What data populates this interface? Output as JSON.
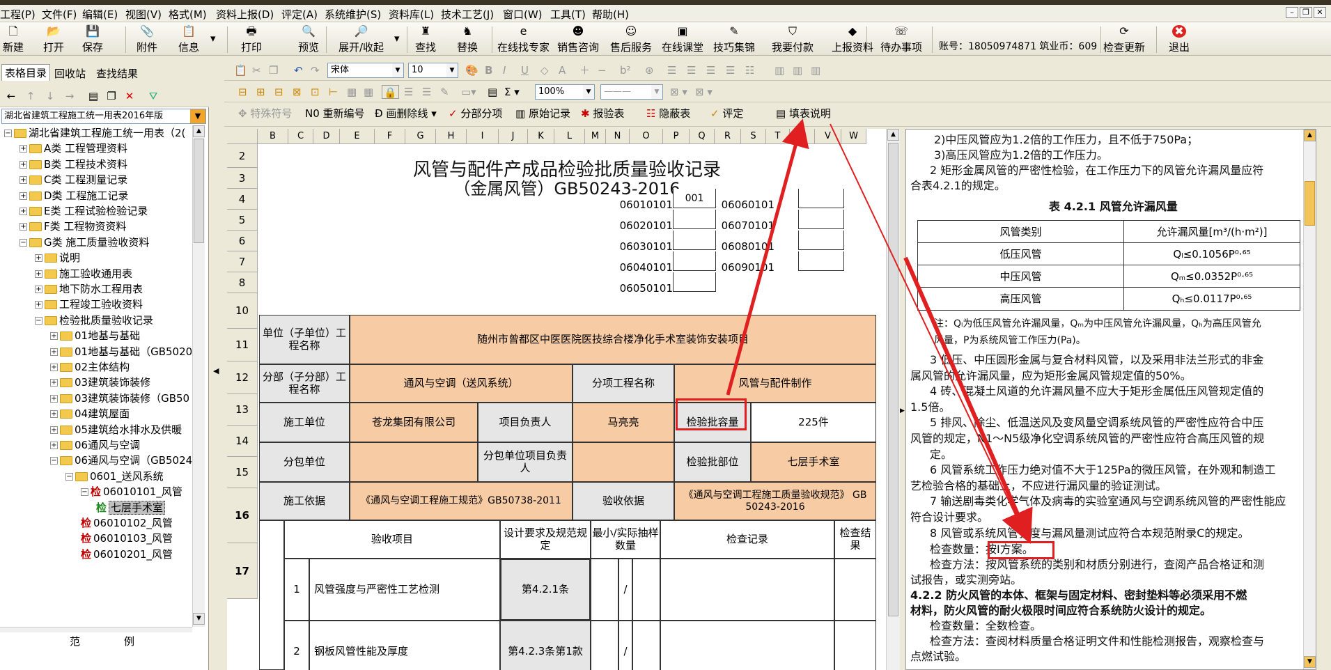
{
  "menu": [
    "工程(P)",
    "文件(F)",
    "编辑(E)",
    "视图(V)",
    "格式(M)",
    "资料上报(D)",
    "评定(A)",
    "系统维护(S)",
    "资料库(L)",
    "技术工艺(J)",
    "窗口(W)",
    "工具(T)",
    "帮助(H)"
  ],
  "window_controls": [
    "–",
    "❐",
    "✕"
  ],
  "toolbar": {
    "items": [
      {
        "label": "新建",
        "icon": "new-icon",
        "glyph": "🗋"
      },
      {
        "label": "打开",
        "icon": "open-icon",
        "glyph": "📂"
      },
      {
        "label": "保存",
        "icon": "save-icon",
        "glyph": "💾"
      },
      {
        "label": "附件",
        "icon": "attachment-icon",
        "glyph": "📎"
      },
      {
        "label": "信息",
        "icon": "info-icon",
        "glyph": "📋"
      },
      {
        "label": "打印",
        "icon": "print-icon",
        "glyph": "🖶"
      },
      {
        "label": "预览",
        "icon": "preview-icon",
        "glyph": "🔍"
      },
      {
        "label": "展开/收起",
        "icon": "expand-icon",
        "glyph": "🔎"
      },
      {
        "label": "查找",
        "icon": "find-icon",
        "glyph": "♜"
      },
      {
        "label": "替换",
        "icon": "replace-icon",
        "glyph": "♞"
      },
      {
        "label": "在线找专家",
        "icon": "expert-icon",
        "glyph": "e"
      },
      {
        "label": "销售咨询",
        "icon": "sales-icon",
        "glyph": "☻"
      },
      {
        "label": "售后服务",
        "icon": "service-icon",
        "glyph": "☺"
      },
      {
        "label": "在线课堂",
        "icon": "classroom-icon",
        "glyph": "▣"
      },
      {
        "label": "技巧集锦",
        "icon": "tips-icon",
        "glyph": "✎"
      },
      {
        "label": "我要付款",
        "icon": "pay-icon",
        "glyph": "⛉"
      },
      {
        "label": "上报资料",
        "icon": "upload-icon",
        "glyph": "◆"
      },
      {
        "label": "待办事项",
        "icon": "todo-icon",
        "glyph": "☏"
      },
      {
        "label": "检查更新",
        "icon": "update-icon",
        "glyph": "⟳"
      },
      {
        "label": "退出",
        "icon": "exit-icon",
        "glyph": "✖"
      }
    ],
    "account": "账号：18050974871 筑业币：609"
  },
  "left": {
    "tabs": [
      "表格目录",
      "回收站",
      "查找结果"
    ],
    "selector": "湖北省建筑工程施工统一用表2016年版",
    "tree": [
      {
        "level": 0,
        "label": "湖北省建筑工程施工统一用表（2(",
        "exp": "−",
        "type": "folder"
      },
      {
        "level": 1,
        "label": "A类 工程管理资料",
        "exp": "+",
        "type": "folder"
      },
      {
        "level": 1,
        "label": "B类 工程技术资料",
        "exp": "+",
        "type": "folder"
      },
      {
        "level": 1,
        "label": "C类 工程测量记录",
        "exp": "+",
        "type": "folder"
      },
      {
        "level": 1,
        "label": "D类 工程施工记录",
        "exp": "+",
        "type": "folder"
      },
      {
        "level": 1,
        "label": "E类 工程试验检验记录",
        "exp": "+",
        "type": "folder"
      },
      {
        "level": 1,
        "label": "F类 工程物资资料",
        "exp": "+",
        "type": "folder"
      },
      {
        "level": 1,
        "label": "G类 施工质量验收资料",
        "exp": "−",
        "type": "folder"
      },
      {
        "level": 2,
        "label": "说明",
        "exp": "+",
        "type": "folder"
      },
      {
        "level": 2,
        "label": "施工验收通用表",
        "exp": "+",
        "type": "folder"
      },
      {
        "level": 2,
        "label": "地下防水工程用表",
        "exp": "+",
        "type": "folder"
      },
      {
        "level": 2,
        "label": "工程竣工验收资料",
        "exp": "+",
        "type": "folder"
      },
      {
        "level": 2,
        "label": "检验批质量验收记录",
        "exp": "−",
        "type": "folder"
      },
      {
        "level": 3,
        "label": "01地基与基础",
        "exp": "+",
        "type": "folder"
      },
      {
        "level": 3,
        "label": "01地基与基础（GB5020",
        "exp": "+",
        "type": "folder"
      },
      {
        "level": 3,
        "label": "02主体结构",
        "exp": "+",
        "type": "folder"
      },
      {
        "level": 3,
        "label": "03建筑装饰装修",
        "exp": "+",
        "type": "folder"
      },
      {
        "level": 3,
        "label": "03建筑装饰装修（GB50",
        "exp": "+",
        "type": "folder"
      },
      {
        "level": 3,
        "label": "04建筑屋面",
        "exp": "+",
        "type": "folder"
      },
      {
        "level": 3,
        "label": "05建筑给水排水及供暖",
        "exp": "+",
        "type": "folder"
      },
      {
        "level": 3,
        "label": "06通风与空调",
        "exp": "+",
        "type": "folder"
      },
      {
        "level": 3,
        "label": "06通风与空调（GB5024",
        "exp": "−",
        "type": "folder"
      },
      {
        "level": 4,
        "label": "0601_送风系统",
        "exp": "−",
        "type": "folder"
      },
      {
        "level": 5,
        "label": "06010101_风管",
        "exp": "−",
        "type": "doc",
        "mark": "检"
      },
      {
        "level": 6,
        "label": "七层手术室",
        "exp": "",
        "type": "docg",
        "mark": "检",
        "selected": true
      },
      {
        "level": 5,
        "label": "06010102_风管",
        "exp": "",
        "type": "doc",
        "mark": "检"
      },
      {
        "level": 5,
        "label": "06010103_风管",
        "exp": "",
        "type": "doc",
        "mark": "检"
      },
      {
        "level": 5,
        "label": "06010201_风管",
        "exp": "",
        "type": "doc",
        "mark": "检"
      }
    ],
    "footer": [
      "范",
      "例"
    ]
  },
  "edit": {
    "font": "宋体",
    "size": "10",
    "zoom": "100%",
    "row3": [
      "特殊符号",
      "重新编号",
      "画删除线",
      "分部分项",
      "原始记录",
      "报验表",
      "隐蔽表",
      "评定",
      "填表说明"
    ]
  },
  "sheet": {
    "cols": [
      "B",
      "C",
      "D",
      "E",
      "F",
      "G",
      "H",
      "I",
      "J",
      "K",
      "L",
      "M",
      "N",
      "O",
      "P",
      "Q",
      "R",
      "S",
      "T",
      "U",
      "V",
      "W"
    ],
    "rows": [
      "2",
      "3",
      "4",
      "5",
      "6",
      "7",
      "8",
      "10",
      "11",
      "12",
      "13",
      "14",
      "15",
      "16",
      "17"
    ],
    "title1": "风管与配件产成品检验批质量验收记录",
    "title2": "（金属风管）GB50243-2016",
    "codes_left": [
      "06010101",
      "06020101",
      "06030101",
      "06040101",
      "06050101"
    ],
    "codes_left_vals": [
      "001",
      "",
      "",
      "",
      ""
    ],
    "codes_right": [
      "06060101",
      "06070101",
      "06080101",
      "06090101"
    ],
    "unit_label": "单位（子单位）工程名称",
    "unit_value": "随州市曾都区中医医院医技综合楼净化手术室装饰安装项目",
    "sub_label": "分部（子分部）工程名称",
    "sub_value": "通风与空调（送风系统）",
    "item_label": "分项工程名称",
    "item_value": "风管与配件制作",
    "constr_label": "施工单位",
    "constr_value": "苍龙集团有限公司",
    "pm_label": "项目负责人",
    "pm_value": "马亮亮",
    "cap_label": "检验批容量",
    "cap_value": "225件",
    "subc_label": "分包单位",
    "subc_pm_label": "分包单位项目负责人",
    "part_label": "检验批部位",
    "part_value": "七层手术室",
    "basis_label": "施工依据",
    "basis_value": "《通风与空调工程施工规范》GB50738-2011",
    "accept_label": "验收依据",
    "accept_value": "《通风与空调工程施工质量验收规范》 GB 50243-2016",
    "hdr_item": "验收项目",
    "hdr_design": "设计要求及规范规定",
    "hdr_sample": "最小/实际抽样数量",
    "hdr_record": "检查记录",
    "hdr_result": "检查结果",
    "r1_no": "1",
    "r1_item": "风管强度与严密性工艺检测",
    "r1_design": "第4.2.1条",
    "r2_no": "2",
    "r2_item": "钢板风管性能及厚度",
    "r2_design": "第4.2.3条第1款",
    "slash": "/"
  },
  "right": {
    "lines": [
      "2)中压风管应为1.2倍的工作压力，且不低于750Pa；",
      "3)高压风管应为1.2倍的工作压力。",
      "2 矩形金属风管的严密性检验，在工作压力下的风管允许漏风量应符",
      "合表4.2.1的规定。"
    ],
    "table_title": "表 4.2.1  风管允许漏风量",
    "table_head": [
      "风管类别",
      "允许漏风量[m³/(h·m²)]"
    ],
    "table_rows": [
      [
        "低压风管",
        "Qₗ≤0.1056P⁰·⁶⁵"
      ],
      [
        "中压风管",
        "Qₘ≤0.0352P⁰·⁶⁵"
      ],
      [
        "高压风管",
        "Qₕ≤0.0117P⁰·⁶⁵"
      ]
    ],
    "note1": "注：Qₗ为低压风管允许漏风量，Qₘ为中压风管允许漏风量，Qₕ为高压风管允",
    "note2": "风量，P为系统风管工作压力(Pa)。",
    "lines2": [
      "3 低压、中压圆形金属与复合材料风管，以及采用非法兰形式的非金",
      "属风管的允许漏风量，应为矩形金属风管规定值的50%。",
      "4 砖、混凝土风道的允许漏风量不应大于矩形金属低压风管规定值的",
      "1.5倍。",
      "5 排风、除尘、低温送风及变风量空调系统风管的严密性应符合中压",
      "风管的规定，N1～N5级净化空调系统风管的严密性应符合高压风管的规",
      "定。",
      "6 风管系统工作压力绝对值不大于125Pa的微压风管，在外观和制造工",
      "艺检验合格的基础上，不应进行漏风量的验证测试。",
      "7 输送剧毒类化学气体及病毒的实验室通风与空调系统风管的严密性能应",
      "符合设计要求。",
      "8 风管或系统风管强度与漏风量测试应符合本规范附录C的规定。"
    ],
    "check_qty": "检查数量：按I方案。",
    "check_method1": "检查方法：按风管系统的类别和材质分别进行，查阅产品合格证和测",
    "check_method2": "试报告，或实测旁站。",
    "bold1": "4.2.2 防火风管的本体、框架与固定材料、密封垫料等必须采用不燃",
    "bold2": "材料，防火风管的耐火极限时间应符合系统防火设计的规定。",
    "qty2": "检查数量：全数检查。",
    "method2": "检查方法：查阅材料质量合格证明文件和性能检测报告，观察检查与",
    "method2b": "点燃试验。"
  },
  "annotation_color": "#e02020"
}
